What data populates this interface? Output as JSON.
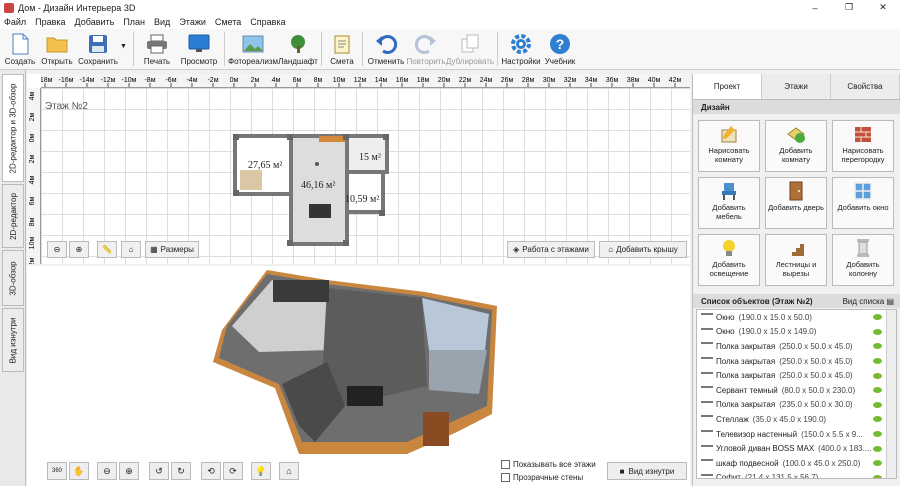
{
  "window": {
    "title": "Дом - Дизайн Интерьера 3D",
    "minimize": "–",
    "maximize": "❐",
    "close": "✕"
  },
  "menu": [
    "Файл",
    "Правка",
    "Добавить",
    "План",
    "Вид",
    "Этажи",
    "Смета",
    "Справка"
  ],
  "toolbar": {
    "create": "Создать",
    "open": "Открыть",
    "save": "Сохранить",
    "print": "Печать",
    "preview": "Просмотр",
    "photorealism": "Фотореализм",
    "landscape": "Ландшафт",
    "estimate": "Смета",
    "undo": "Отменить",
    "redo": "Повторить",
    "duplicate": "Дублировать",
    "settings": "Настройки",
    "tutorial": "Учебник"
  },
  "left_tabs": [
    "2D-редактор и 3D-обзор",
    "2D-редактор",
    "3D-обзор",
    "Вид изнутри"
  ],
  "editor2d": {
    "floor_label": "Этаж №2",
    "ruler_top": [
      "-18м",
      "-16м",
      "-14м",
      "-12м",
      "-10м",
      "-8м",
      "-6м",
      "-4м",
      "-2м",
      "0м",
      "2м",
      "4м",
      "6м",
      "8м",
      "10м",
      "12м",
      "14м",
      "16м",
      "18м",
      "20м",
      "22м",
      "24м",
      "26м",
      "28м",
      "30м",
      "32м",
      "34м",
      "36м",
      "38м",
      "40м",
      "42м"
    ],
    "ruler_left": [
      "4м",
      "2м",
      "0м",
      "2м",
      "4м",
      "6м",
      "8м",
      "10м",
      "12м"
    ],
    "rooms": {
      "r1": "27,65 м²",
      "r2": "46,16 м²",
      "r3": "15 м²",
      "r4": "10,59 м²"
    },
    "sizes_btn": "Размеры",
    "floors_btn": "Работа с этажами",
    "roof_btn": "Добавить крышу"
  },
  "right": {
    "tabs": [
      "Проект",
      "Этажи",
      "Свойства"
    ],
    "design_header": "Дизайн",
    "tools": [
      "Нарисовать комнату",
      "Добавить комнату",
      "Нарисовать перегородку",
      "Добавить мебель",
      "Добавить дверь",
      "Добавить окно",
      "Добавить освещение",
      "Лестницы и вырезы",
      "Добавить колонну"
    ],
    "list_header": "Список объектов (Этаж №2)",
    "list_view": "Вид списка",
    "objects": [
      {
        "name": "Окно",
        "dim": "(190.0 x 15.0 x 50.0)"
      },
      {
        "name": "Окно",
        "dim": "(190.0 x 15.0 x 149.0)"
      },
      {
        "name": "Полка закрытая",
        "dim": "(250.0 x 50.0 x 45.0)"
      },
      {
        "name": "Полка закрытая",
        "dim": "(250.0 x 50.0 x 45.0)"
      },
      {
        "name": "Полка закрытая",
        "dim": "(250.0 x 50.0 x 45.0)"
      },
      {
        "name": "Сервант темный",
        "dim": "(80.0 x 50.0 x 230.0)"
      },
      {
        "name": "Полка закрытая",
        "dim": "(235.0 x 50.0 x 30.0)"
      },
      {
        "name": "Стеллаж",
        "dim": "(35.0 x 45.0 x 190.0)"
      },
      {
        "name": "Телевизор настенный",
        "dim": "(150.0 x 5.5 x 9..."
      },
      {
        "name": "Угловой диван BOSS MAX",
        "dim": "(400.0 x 183...."
      },
      {
        "name": "шкаф подвесной",
        "dim": "(100.0 x 45.0 x 250.0)"
      },
      {
        "name": "Софит",
        "dim": "(21.4 x 131.5 x 56.7)"
      }
    ]
  },
  "bottom": {
    "show_all_floors": "Показывать все этажи",
    "transparent_walls": "Прозрачные стены",
    "inside_view": "Вид изнутри",
    "view360": "360"
  }
}
